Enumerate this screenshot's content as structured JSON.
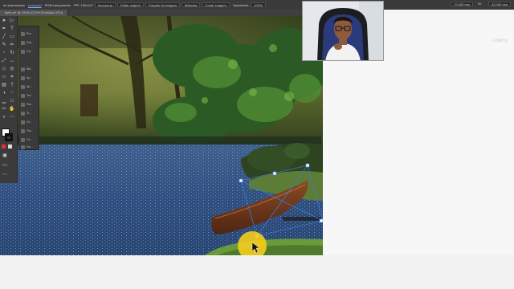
{
  "control_bar": {
    "items": [
      "do selecionado",
      "roma.psd",
      "RGB transparente",
      "PPI: 150x147",
      "Incorporar",
      "Editar original",
      "Traçado da imagem",
      "Máscara",
      "Cortar imagem",
      "Opacidade:",
      "100%"
    ],
    "right_fields": [
      "72,000 mm",
      "W:",
      "42,000 mm"
    ]
  },
  "document_tab": {
    "label": "bjeto.ai* @ 100% (CMYK/Exibição GPU)"
  },
  "watermark": "Udemy",
  "tools": {
    "icons": [
      "select-arrow-icon",
      "direct-select-icon",
      "pen-icon",
      "type-icon",
      "line-icon",
      "rectangle-icon",
      "brush-icon",
      "pencil-icon",
      "eraser-icon",
      "rotate-icon",
      "scale-icon",
      "width-icon",
      "free-transform-icon",
      "shape-builder-icon",
      "perspective-icon",
      "mesh-icon",
      "gradient-icon",
      "eyedropper-icon",
      "blend-icon",
      "symbol-sprayer-icon",
      "graph-icon",
      "artboard-icon",
      "slice-icon",
      "hand-icon",
      "zoom-icon"
    ],
    "colors": {
      "fill": "#ffffff",
      "stroke": "#000000"
    }
  },
  "panel_dock": {
    "items": [
      "Pro...",
      "Exe...",
      "Ca...",
      "Bib...",
      "Ap...",
      "Ali...",
      "Tra...",
      "Pat...",
      "Tr...",
      "Gr...",
      "Tra...",
      "Ce...",
      "Da..."
    ]
  },
  "colors": {
    "cursor_highlight": "#f4cd1c",
    "selection": "#3a7bd5"
  }
}
